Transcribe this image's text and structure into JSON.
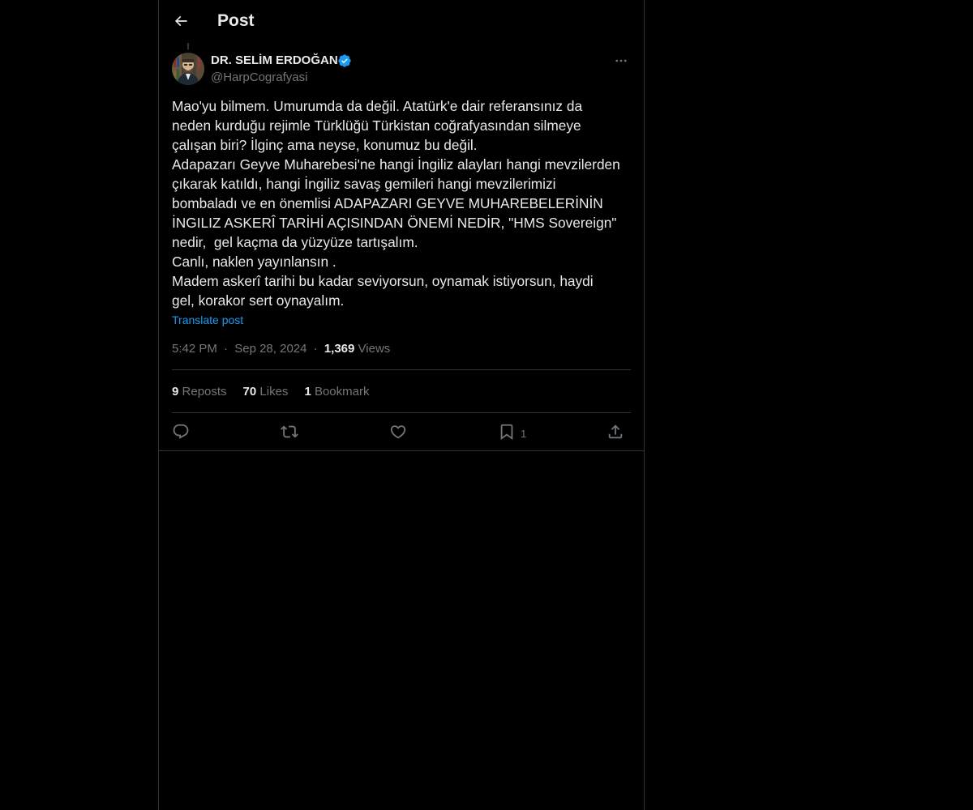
{
  "header": {
    "title": "Post",
    "back_icon": "arrow-left-icon"
  },
  "author": {
    "name": "DR. SELİM ERDOĞAN",
    "handle": "@HarpCografyasi",
    "verified": true,
    "verified_color": "#1d9bf0"
  },
  "post": {
    "text": "Mao'yu bilmem. Umurumda da değil. Atatürk'e dair referansınız da\nneden kurduğu rejimle Türklüğü Türkistan coğrafyasından silmeye\nçalışan biri? İlginç ama neyse, konumuz bu değil.\nAdapazarı Geyve Muharebesi'ne hangi İngiliz alayları hangi mevzilerden\nçıkarak katıldı, hangi İngiliz savaş gemileri hangi mevzilerimizi\nbombaladı ve en önemlisi ADAPAZARI GEYVE MUHAREBELERİNİN\nİNGILIZ ASKERÎ TARİHİ AÇISINDAN ÖNEMİ NEDİR, \"HMS Sovereign\"\nnedir,  gel kaçma da yüzyüze tartışalım.\nCanlı, naklen yayınlansın .\nMadem askerî tarihi bu kadar seviyorsun, oynamak istiyorsun, haydi\ngel, korakor sert oynayalım.",
    "translate_label": "Translate post",
    "time": "5:42 PM",
    "date": "Sep 28, 2024",
    "separator": "·",
    "views_count": "1,369",
    "views_label": "Views"
  },
  "stats": {
    "reposts_count": "9",
    "reposts_label": "Reposts",
    "likes_count": "70",
    "likes_label": "Likes",
    "bookmarks_count": "1",
    "bookmarks_label": "Bookmark"
  },
  "actions": {
    "reply_icon": "reply-icon",
    "repost_icon": "repost-icon",
    "like_icon": "heart-icon",
    "bookmark_icon": "bookmark-icon",
    "bookmark_count": "1",
    "share_icon": "share-icon"
  },
  "colors": {
    "background": "#000000",
    "text": "#e7e9ea",
    "muted": "#71767b",
    "accent": "#1d9bf0",
    "border": "#2f3336"
  }
}
